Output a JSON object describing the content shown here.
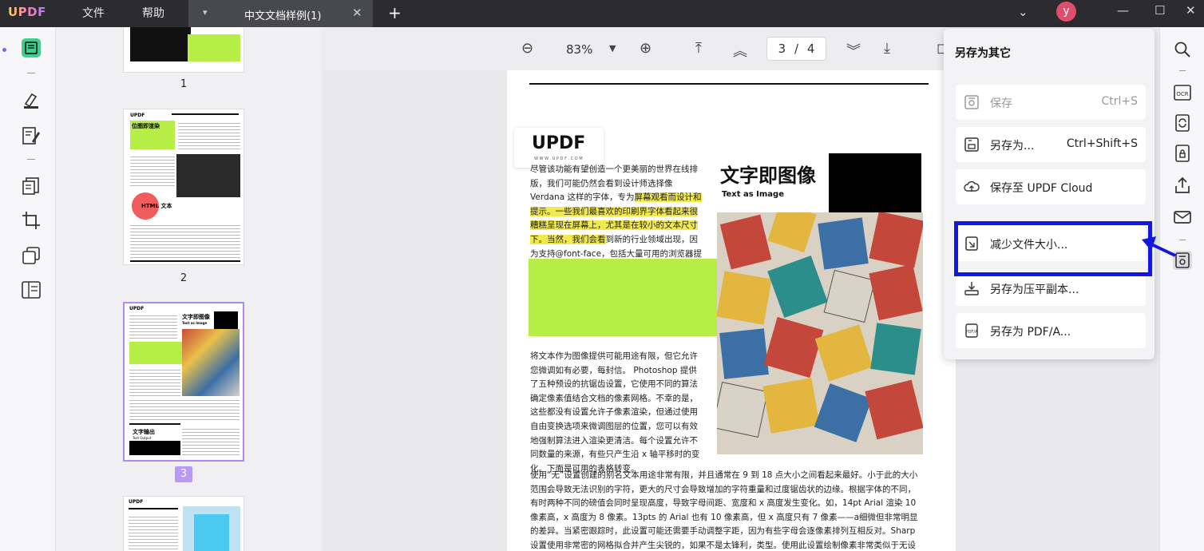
{
  "app": {
    "logo": "UPDF",
    "menu": [
      "文件",
      "帮助"
    ],
    "tab_title": "中文文档样例(1)",
    "avatar_letter": "y"
  },
  "toolbar": {
    "zoom": "83%",
    "page_current": "3",
    "page_sep": "/",
    "page_total": "4"
  },
  "thumbnails": {
    "pages": [
      "1",
      "2",
      "3"
    ],
    "selected": "3"
  },
  "document": {
    "logo": "UPDF",
    "logo_url": "W W W . U P D F . C O M",
    "title": "文字即图像",
    "subtitle": "Text as Image",
    "para1_a": "尽管该功能有望创造一个更美丽的世界在线排版，我们可能仍然会看到设计师选择像Verdana 这样的字体，专为",
    "para1_hl": "屏幕观看而设计和提示。一些我们最喜欢的印刷界字体看起来很糟糕呈现在屏幕上，尤其是在较小的文本尺寸下。当然，我们会看",
    "para1_b": "到新的行业领域出现，因为支持@font-face，包括大量可用的浏览器提示字体通过 typekit 等服务。",
    "para2": "将文本作为图像提供可能用途有限，但它允许您微调如有必要，每封信。 Photoshop 提供了五种预设的抗锯齿设置，它使用不同的算法确定像素值结合文档的像素网格。不幸的是，这些都没有设置允许子像素渲染，但通过使用自由变换选项来微调图层的位置，您可以有效地强制算法进入渲染更清洁。每个设置允许不同数量的来源，有些只产生沿 x 轴平移时的变化。下面是可用的表格转变。",
    "para3": "使用“无”设置创建的别名文本用途非常有限，并且通常在 9 到 18 点大小之间看起来最好。小于此的大小范围会导致无法识别的字符，更大的尺寸会导致增加的字符重量和过度锯齿状的边缘。根据字体的不同，有时两种不同的磅值会同时呈现高度，导致字母间距、宽度和 x 高度发生变化。如，14pt Arial 渲染 10 像素高，x 高度为 8 像素。13pts 的 Arial 也有 10 像素高，但 x 高度只有 7 像素——a细微但非常明显的差异。当紧密跟踪时，此设置可能还需要手动调整字距，因为有些字母会逐像素排列互相反对。Sharp 设置使用非常密的网格拟合并产生尖锐的，如果不是太锋利，类型。使用此设置绘制像素非常类似于无设置绘制它们，但允许一定程度的平滑。在事实上，如果像素是相互重叠的，你实际上可以看到大"
  },
  "thumb_text": {
    "p2_title": "位图即渲染",
    "p2_html": "HTML 文本",
    "p3_title": "文字即图像",
    "p3_sub": "Text as Image",
    "p3_out": "文字输出",
    "p3_out_sub": "Text Output"
  },
  "saveas": {
    "header": "另存为其它",
    "items": [
      {
        "label": "保存",
        "shortcut": "Ctrl+S"
      },
      {
        "label": "另存为...",
        "shortcut": "Ctrl+Shift+S"
      },
      {
        "label": "保存至 UPDF Cloud",
        "shortcut": ""
      },
      {
        "label": "减少文件大小...",
        "shortcut": ""
      },
      {
        "label": "另存为压平副本...",
        "shortcut": ""
      },
      {
        "label": "另存为 PDF/A...",
        "shortcut": ""
      }
    ]
  },
  "colors": {
    "highlight_box": "#1318e0",
    "lime": "#b6ed47",
    "accent": "#8b5cf6",
    "avatar": "#e04e6e"
  }
}
